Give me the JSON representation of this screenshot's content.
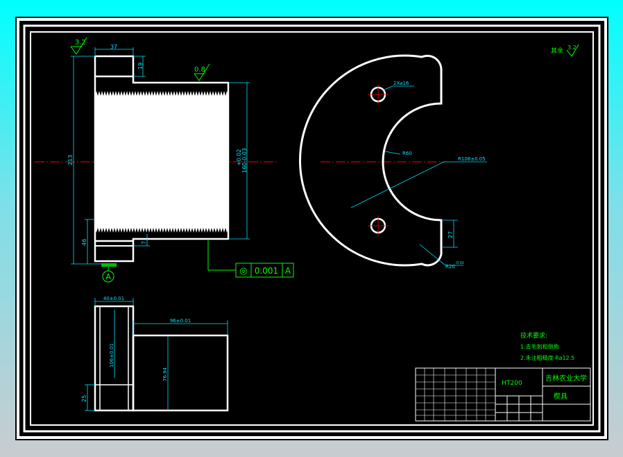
{
  "colors": {
    "background": "#000000",
    "outline": "#ffffff",
    "dimension": "#00e5ff",
    "centerline": "#ff0000",
    "annotation": "#00ff00",
    "datum_fill": "#00c000"
  },
  "roughness": {
    "top_left": "3.2",
    "top_face": "0.8",
    "other": "其余",
    "other_value": "3.2"
  },
  "front_view": {
    "dim_width_top": "37",
    "dim_collar": "19",
    "dim_total_height": "213",
    "dim_diameter_upper": "+0.02",
    "dim_diameter_main": "160-0.03",
    "dim_lower": "46",
    "dim_step": "7",
    "datum": "A"
  },
  "tolerance_frame": {
    "symbol": "◎",
    "value": "0.001",
    "datum": "A"
  },
  "side_view": {
    "dim_holes": "2X⌀16",
    "dim_inner_radius": "R60",
    "dim_outer_radius": "R108±0.05",
    "dim_tab": "27",
    "dim_corner_radius": "R20",
    "dim_corner_tol": "-0.02"
  },
  "bottom_view": {
    "dim_left_width": "40±0.01",
    "dim_right_width": "96±0.01",
    "dim_left_height": "106±0.01",
    "dim_right_height": "76.94",
    "dim_bottom": "25"
  },
  "notes": {
    "heading": "技术要求:",
    "line1": "1.去毛刺和倒角",
    "line2": "2.未注粗糙度 Ra12.5"
  },
  "title_block": {
    "material": "HT200",
    "school": "吉林农业大学",
    "part_name": "楔具"
  }
}
